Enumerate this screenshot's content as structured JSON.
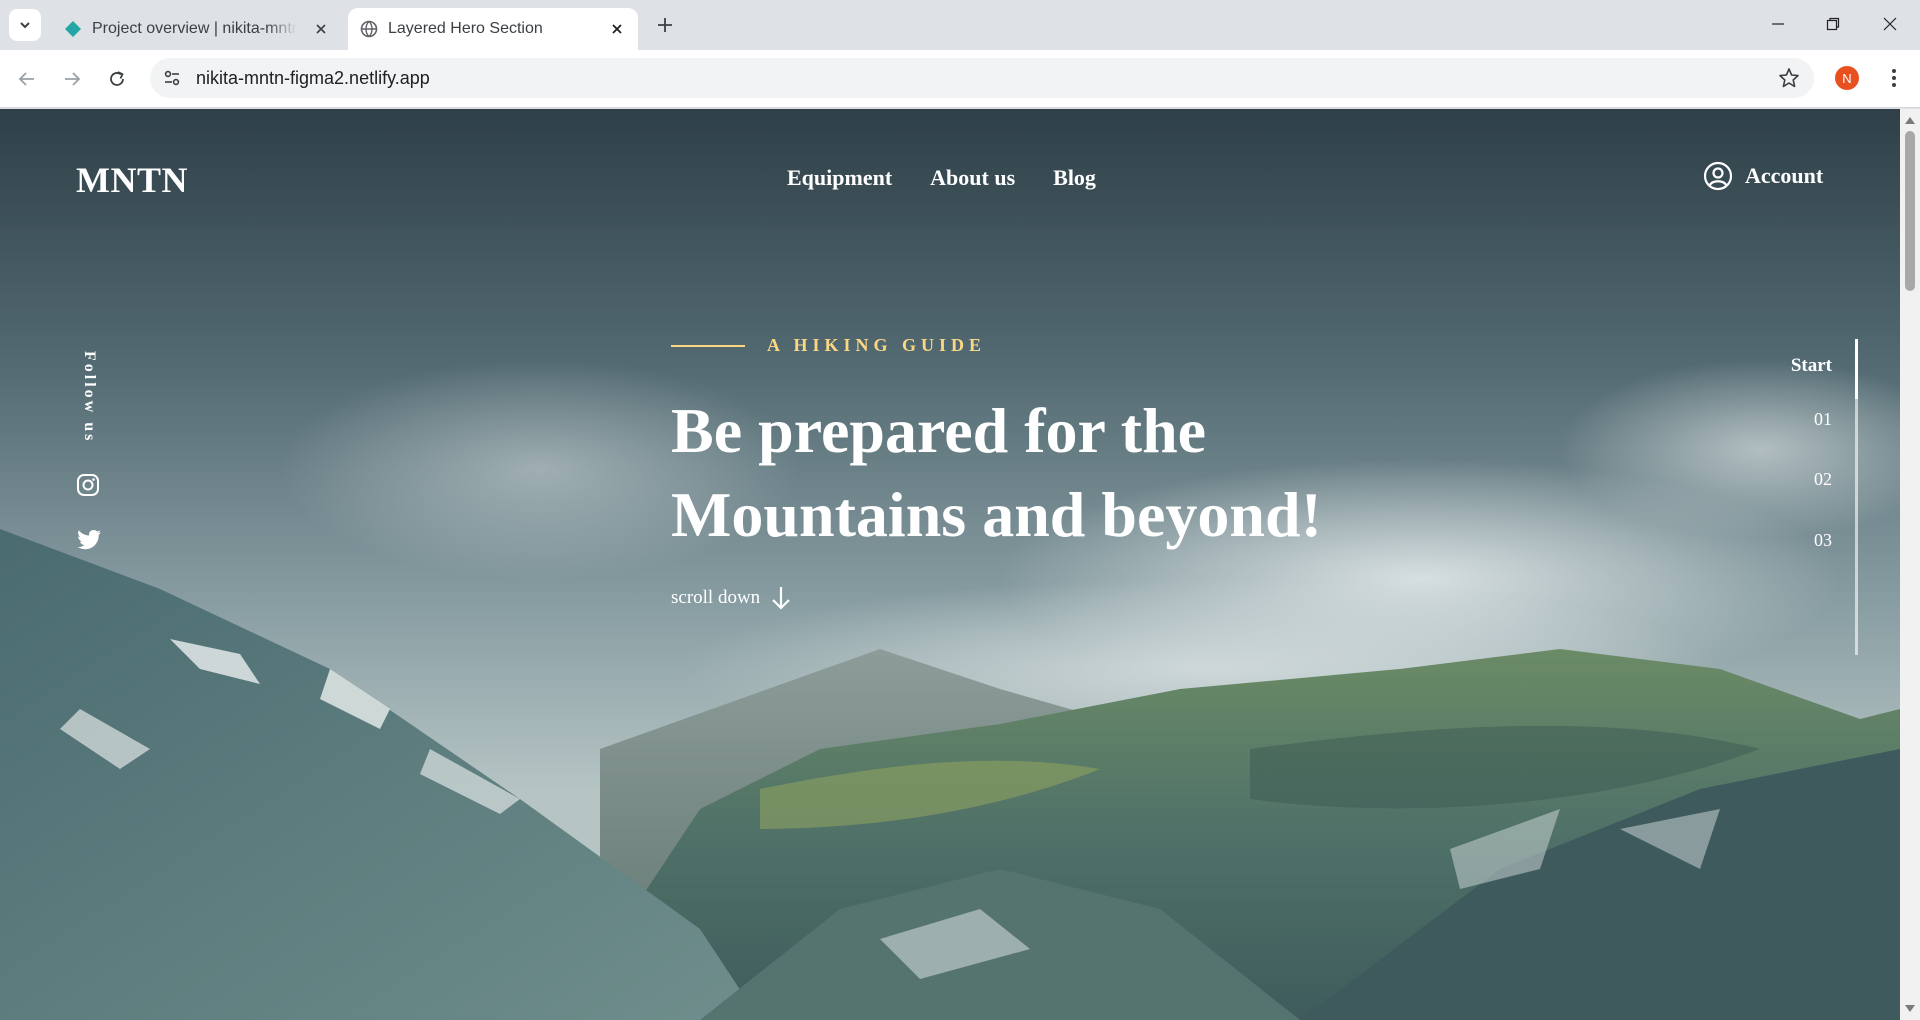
{
  "browser": {
    "tabs": [
      {
        "title": "Project overview | nikita-mntn-f",
        "active": false
      },
      {
        "title": "Layered Hero Section",
        "active": true
      }
    ],
    "url": "nikita-mntn-figma2.netlify.app",
    "profile_initial": "N"
  },
  "site": {
    "logo": "MNTN",
    "nav": [
      "Equipment",
      "About us",
      "Blog"
    ],
    "account_label": "Account",
    "follow_label": "Follow us",
    "social_icons": [
      "instagram-icon",
      "twitter-icon"
    ]
  },
  "hero": {
    "eyebrow": "A HIKING GUIDE",
    "headline_line1": "Be prepared for the",
    "headline_line2": "Mountains and beyond!",
    "scroll_label": "scroll down"
  },
  "stepper": {
    "items": [
      "Start",
      "01",
      "02",
      "03"
    ],
    "active_index": 0
  },
  "colors": {
    "accent": "#fbd784",
    "text": "#ffffff",
    "sky_top": "#2e4048",
    "mountain": "#4d6e6a",
    "profile": "#e8501f"
  }
}
